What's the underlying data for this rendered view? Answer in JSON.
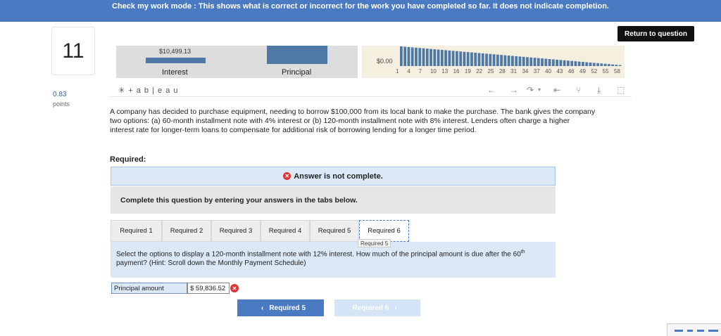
{
  "banner": {
    "text": "Check my work mode : This shows what is correct or incorrect for the work you have completed so far. It does not indicate completion."
  },
  "return_button": "Return to question",
  "question_number": "11",
  "points": {
    "value": "0.83",
    "label": "points"
  },
  "chart": {
    "interest_value": "$10,499.13",
    "interest_label": "Interest",
    "principal_label": "Principal",
    "y_zero": "$0.00",
    "x_ticks": [
      "1",
      "4",
      "7",
      "10",
      "13",
      "16",
      "19",
      "22",
      "25",
      "28",
      "31",
      "34",
      "37",
      "40",
      "43",
      "46",
      "49",
      "52",
      "55",
      "58"
    ],
    "bar_color": "#4e79a7"
  },
  "tableau": {
    "logo": "+ a b | e a u",
    "icons": [
      "undo-icon",
      "redo-icon",
      "revert-icon",
      "reset-icon",
      "share-icon",
      "download-icon",
      "fullscreen-icon"
    ]
  },
  "question_text": "A company has decided to purchase equipment, needing to borrow $100,000 from its local bank to make the purchase. The bank gives the company two options: (a) 60-month installment note with 4% interest or (b) 120-month installment note with 8% interest. Lenders often charge a higher interest rate for longer-term loans to compensate for additional risk of borrowing lending for a longer time period.",
  "required_heading": "Required:",
  "status": "Answer is not complete.",
  "instructions": "Complete this question by entering your answers in the tabs below.",
  "tabs": [
    "Required 1",
    "Required 2",
    "Required 3",
    "Required 4",
    "Required 5",
    "Required 6"
  ],
  "tooltip": "Required 5",
  "prompt": {
    "part1": "Select the options to display a 120-month installment note with 12% interest. How much of the principal amount is due after the 60",
    "sup": "th",
    "part2": " payment? (Hint: Scroll down the Monthly Payment Schedule)"
  },
  "answer": {
    "label": "Principal amount",
    "value": "$ 59,836.52"
  },
  "nav": {
    "prev": "Required 5",
    "next": "Required 6"
  }
}
